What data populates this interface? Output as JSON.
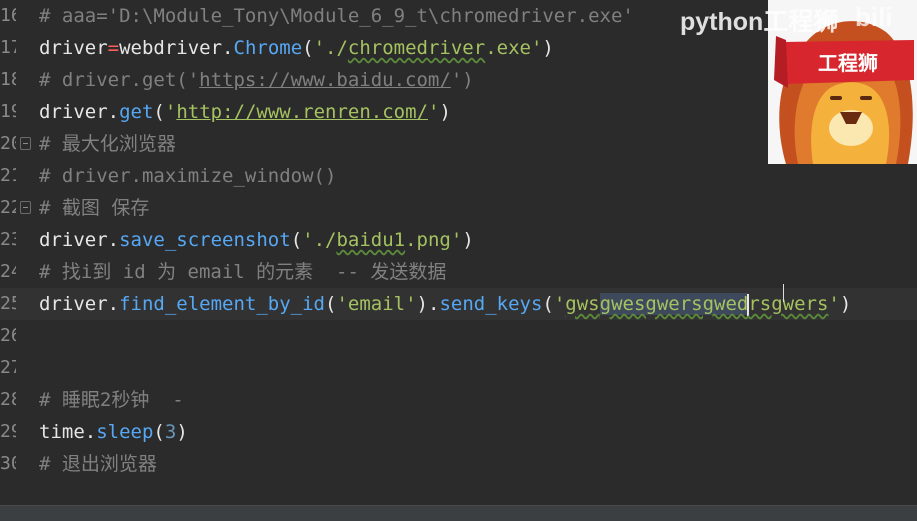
{
  "editor": {
    "gutter": [
      "16",
      "17",
      "18",
      "19",
      "20",
      "21",
      "22",
      "23",
      "24",
      "25",
      "26",
      "27",
      "28",
      "29",
      "30"
    ],
    "lines": {
      "l16": {
        "comment": "# aaa='D:\\Module_Tony\\Module_6_9_t\\chromedriver.exe'"
      },
      "l17": {
        "a": "driver",
        "op": "=",
        "b": "webdriver",
        "c": ".",
        "d": "Chrome",
        "e": "(",
        "f": "'./",
        "g": "chromedriver",
        "h": ".exe'",
        "i": ")"
      },
      "l18": {
        "a": "# driver.get('",
        "b": "https://www.baidu.com/",
        "c": "')"
      },
      "l19": {
        "a": "driver",
        "b": ".",
        "c": "get",
        "d": "(",
        "e": "'",
        "f": "http://www.renren.com/",
        "g": "'",
        "h": ")"
      },
      "l20": {
        "comment": "# 最大化浏览器"
      },
      "l21": {
        "comment": "# driver.maximize_window()"
      },
      "l22": {
        "comment": "# 截图 保存"
      },
      "l23": {
        "a": "driver",
        "b": ".",
        "c": "save_screenshot",
        "d": "(",
        "e": "'./",
        "f": "baidu1",
        "g": ".png'",
        "h": ")"
      },
      "l24": {
        "comment": "# 找i到 id 为 email 的元素  -- 发送数据"
      },
      "l25": {
        "a": "driver",
        "b": ".",
        "c": "find_element_by_id",
        "d": "(",
        "e": "'email'",
        "f": ")",
        "g": ".",
        "h": "send_keys",
        "i": "(",
        "j": "'",
        "k": "gws",
        "l": "gwesgwersgwed",
        "m": "rsgwers",
        "n": "'",
        "o": ")"
      },
      "l28": {
        "comment": "# 睡眠2秒钟  -"
      },
      "l29": {
        "a": "time",
        "b": ".",
        "c": "sleep",
        "d": "(",
        "e": "3",
        "f": ")"
      },
      "l30": {
        "comment": "# 退出浏览器"
      }
    }
  },
  "overlay": {
    "watermark_text": "python工程狮",
    "logo_text": "bili",
    "avatar_banner": "工程狮"
  },
  "colors": {
    "background": "#2b2b2b",
    "comment": "#808080",
    "function": "#56a8f5",
    "string": "#c5d67a",
    "number": "#6897bb",
    "operator": "#ff5e5e"
  }
}
